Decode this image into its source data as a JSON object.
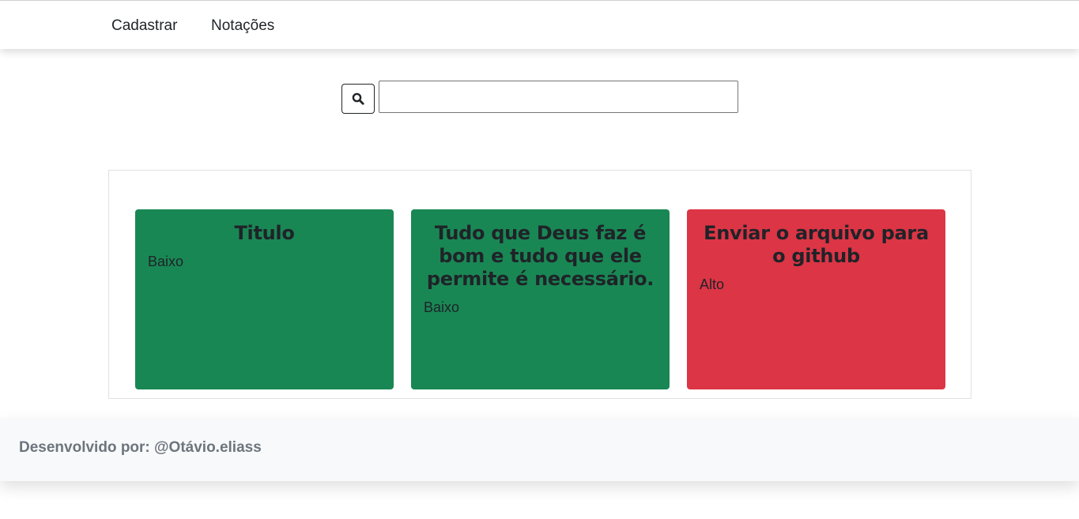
{
  "navbar": {
    "links": [
      "Cadastrar",
      "Notações"
    ]
  },
  "search": {
    "icon": "search-icon",
    "value": "",
    "placeholder": ""
  },
  "notes": [
    {
      "title": "Titulo",
      "priority": "Baixo",
      "color": "#198754"
    },
    {
      "title": "Tudo que Deus faz é bom e tudo que ele permite é necessário.",
      "priority": "Baixo",
      "color": "#198754"
    },
    {
      "title": "Enviar o arquivo para o github",
      "priority": "Alto",
      "color": "#dc3545"
    }
  ],
  "footer": {
    "text": "Desenvolvido por: @Otávio.eliass"
  }
}
